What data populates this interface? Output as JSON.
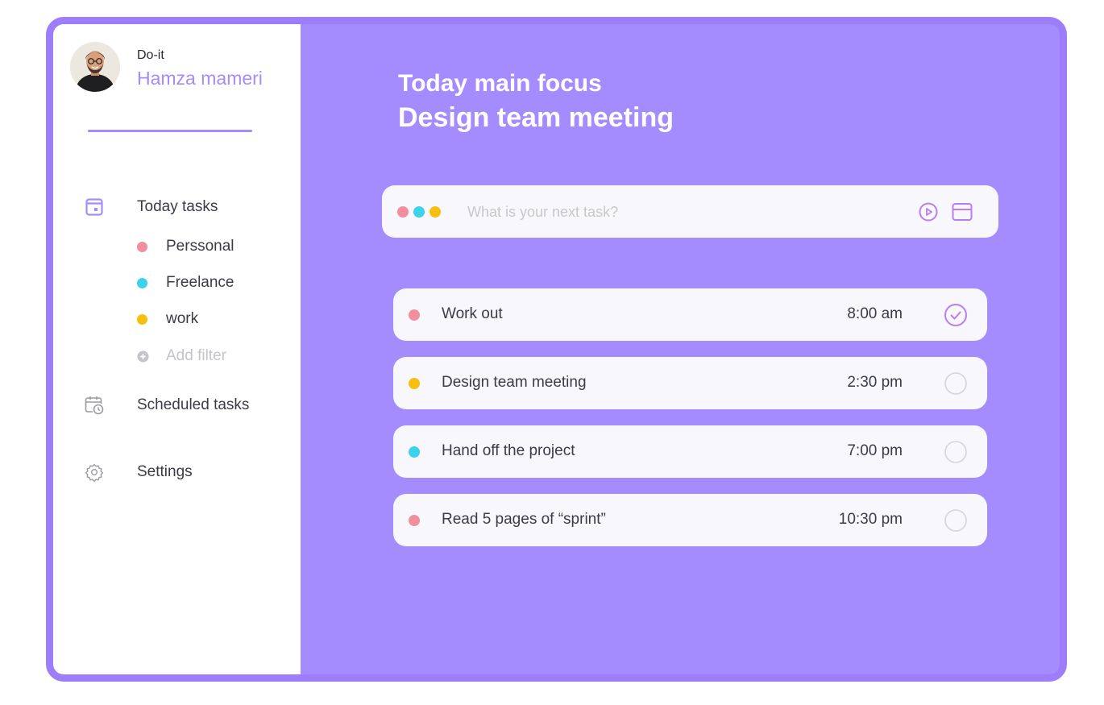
{
  "user": {
    "app_name": "Do-it",
    "name": "Hamza mameri"
  },
  "sidebar": {
    "today_tasks": {
      "label": "Today tasks",
      "icon": "calendar-today-icon"
    },
    "filters": [
      {
        "label": "Perssonal",
        "color": "#f28f9f"
      },
      {
        "label": "Freelance",
        "color": "#3dd2ec"
      },
      {
        "label": "work",
        "color": "#f6c010"
      }
    ],
    "add_filter": {
      "label": "Add filter",
      "icon": "plus-circle-icon"
    },
    "scheduled_tasks": {
      "label": "Scheduled tasks",
      "icon": "calendar-clock-icon"
    },
    "settings": {
      "label": "Settings",
      "icon": "gear-icon"
    }
  },
  "main": {
    "focus_label": "Today main focus",
    "focus_title": "Design team meeting",
    "task_input": {
      "placeholder": "What is your next task?",
      "dot_colors": [
        "#f28f9f",
        "#3dd2ec",
        "#f6c010"
      ]
    },
    "tasks": [
      {
        "name": "Work out",
        "time": "8:00 am",
        "color": "#f28f9f",
        "done": true
      },
      {
        "name": "Design team meeting",
        "time": "2:30 pm",
        "color": "#f6c010",
        "done": false
      },
      {
        "name": "Hand off the project",
        "time": "7:00 pm",
        "color": "#3dd2ec",
        "done": false
      },
      {
        "name": "Read 5 pages of “sprint”",
        "time": "10:30 pm",
        "color": "#f28f9f",
        "done": false
      }
    ]
  },
  "colors": {
    "accent": "#a48cff",
    "frame_border": "#9d7dfa",
    "card": "#f8f8fc",
    "check_done": "#b77ef5",
    "check_pending": "#d4d4d8"
  }
}
